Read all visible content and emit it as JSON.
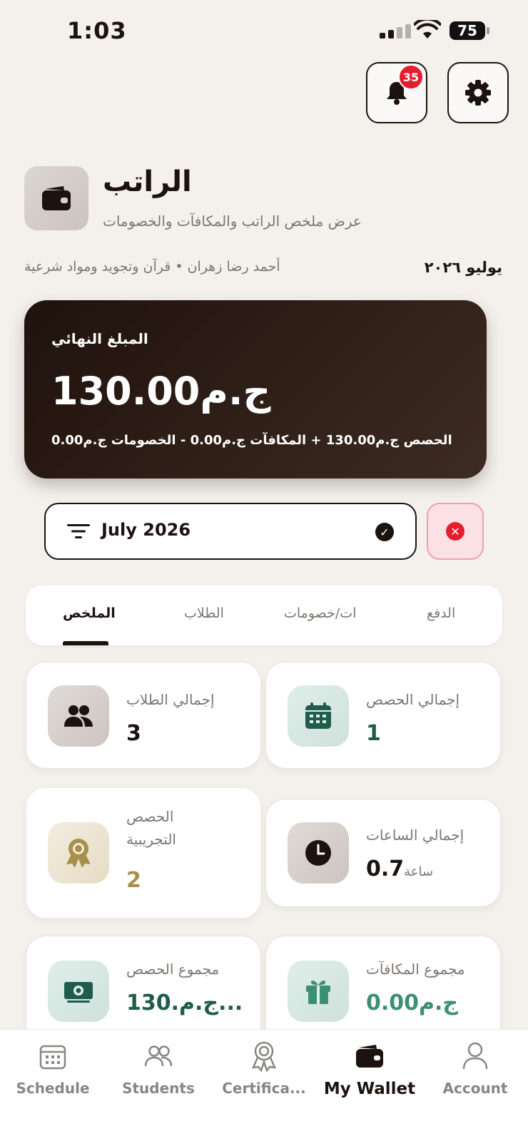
{
  "status_bar": {
    "time": "1:03",
    "battery": "75"
  },
  "header": {
    "notification_count": "35"
  },
  "page": {
    "title": "الراتب",
    "subtitle": "عرض ملخص الراتب والمكافآت والخصومات",
    "teacher_line": "أحمد رضا زهران • قرآن وتجويد ومواد شرعية",
    "month_ar": "يوليو ٢٠٢٦"
  },
  "final_card": {
    "label": "المبلغ النهائي",
    "amount": "130.00ج.م",
    "breakdown": "الحصص ج.م130.00 + المكافآت ج.م0.00 - الخصومات ج.م0.00"
  },
  "filter": {
    "value": "July 2026"
  },
  "tabs": [
    {
      "label": "الملخص",
      "active": true
    },
    {
      "label": "الطلاب",
      "active": false
    },
    {
      "label": "ات/خصومات",
      "active": false
    },
    {
      "label": "الدفع",
      "active": false
    }
  ],
  "stats": {
    "total_sessions": {
      "label": "إجمالي الحصص",
      "value": "1"
    },
    "total_students": {
      "label": "إجمالي الطلاب",
      "value": "3"
    },
    "total_hours": {
      "label": "إجمالي الساعات",
      "value": "0.7",
      "unit": "ساعة"
    },
    "trial_sessions": {
      "label": "الحصص التجريبية",
      "value": "2"
    },
    "bonuses_total": {
      "label": "مجموع المكافآت",
      "value": "ج.م0.00"
    },
    "sessions_total": {
      "label": "مجموع الحصص",
      "value": "130.ج.م..."
    }
  },
  "colors": {
    "dark": "#1c1210",
    "green": "#1f5c4c",
    "gold": "#a8904a",
    "red": "#e41e2d"
  },
  "nav": [
    {
      "label": "Schedule",
      "icon": "calendar-icon"
    },
    {
      "label": "Students",
      "icon": "users-icon"
    },
    {
      "label": "Certifica...",
      "icon": "certificate-icon"
    },
    {
      "label": "My Wallet",
      "icon": "wallet-icon",
      "active": true
    },
    {
      "label": "Account",
      "icon": "user-icon"
    }
  ]
}
